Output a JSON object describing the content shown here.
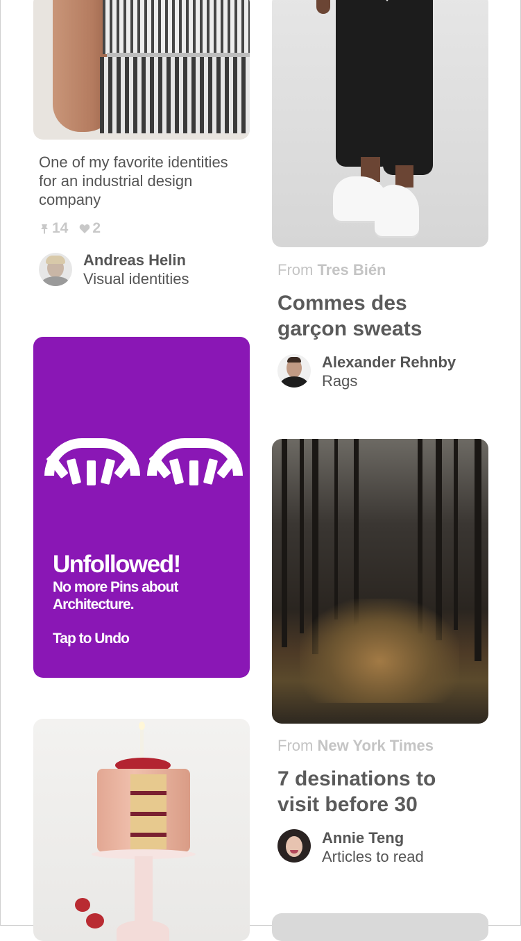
{
  "pin_stripes": {
    "description": "One of my favorite identities for an industrial design company",
    "repins": "14",
    "likes": "2",
    "user_name": "Andreas Helin",
    "board": "Visual identities"
  },
  "pin_sweats": {
    "from_label": "From",
    "source": "Tres Bién",
    "title": "Commes des garçon sweats",
    "user_name": "Alexander Rehnby",
    "board": "Rags"
  },
  "unfollow_card": {
    "heading": "Unfollowed!",
    "message": "No more Pins about Architecture.",
    "action": "Tap to Undo",
    "color": "#8a17b5"
  },
  "pin_forest": {
    "from_label": "From",
    "source": "New York Times",
    "title": "7 desinations to visit before 30",
    "user_name": "Annie Teng",
    "board": "Articles to read"
  },
  "icons": {
    "repin": "pin-icon",
    "like": "heart-icon"
  }
}
